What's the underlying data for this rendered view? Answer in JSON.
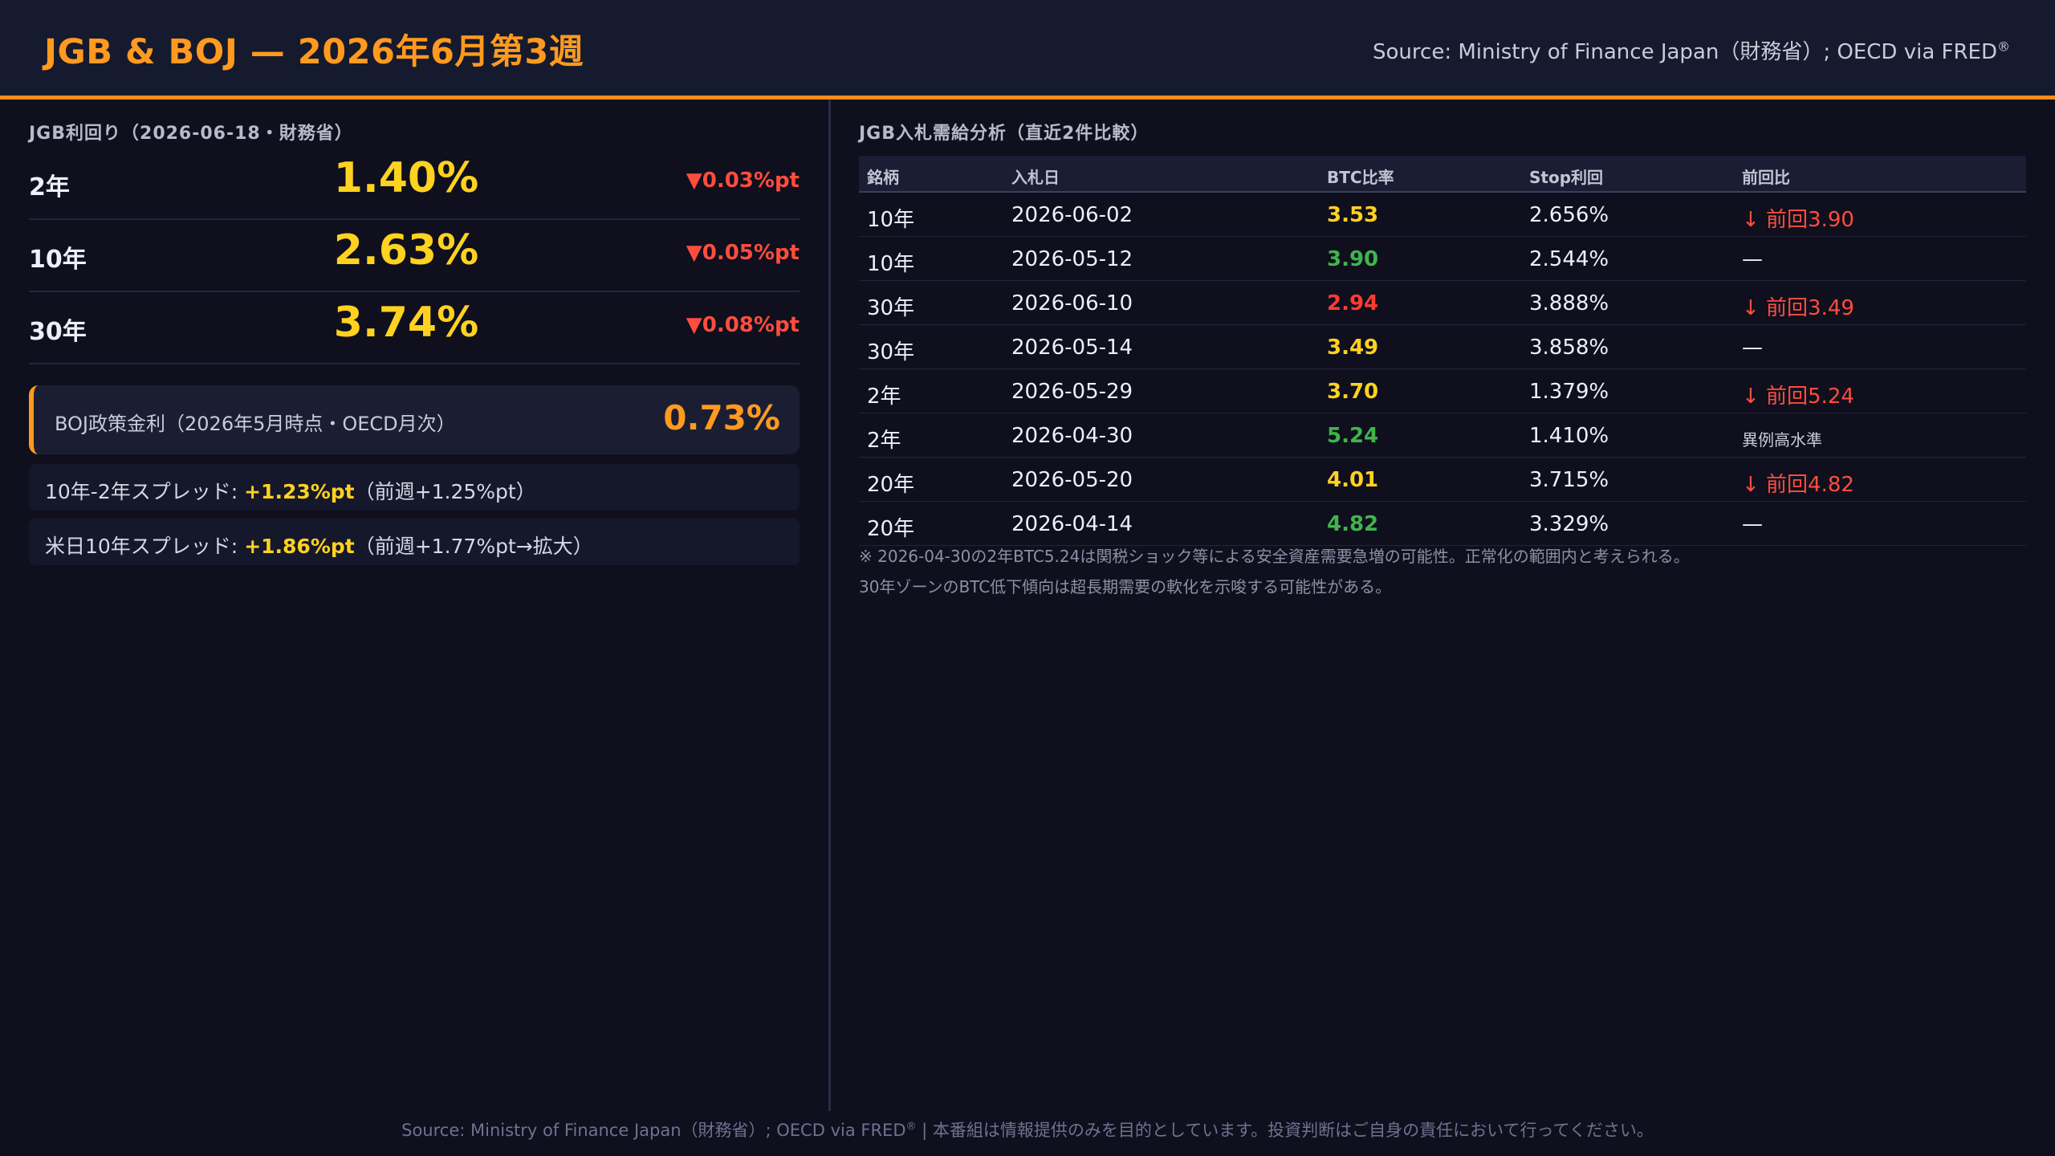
{
  "header": {
    "title": "JGB & BOJ — 2026年6月第3週",
    "source": "Source: Ministry of Finance Japan（財務省）; OECD via FRED",
    "source_mark": "®"
  },
  "yields": {
    "section_label": "JGB利回り（2026-06-18・財務省）",
    "rows": [
      {
        "tenor": "2年",
        "rate": "1.40%",
        "change": "▼0.03%pt"
      },
      {
        "tenor": "10年",
        "rate": "2.63%",
        "change": "▼0.05%pt"
      },
      {
        "tenor": "30年",
        "rate": "3.74%",
        "change": "▼0.08%pt"
      }
    ]
  },
  "boj": {
    "label": "BOJ政策金利（2026年5月時点・OECD月次）",
    "value": "0.73%"
  },
  "spreads": [
    {
      "prefix": "10年-2年スプレッド: ",
      "value": "+1.23%pt",
      "suffix": "（前週+1.25%pt）"
    },
    {
      "prefix": "米日10年スプレッド: ",
      "value": "+1.86%pt",
      "suffix": "（前週+1.77%pt→拡大）"
    }
  ],
  "auction": {
    "section_label": "JGB入札需給分析（直近2件比較）",
    "columns": [
      "銘柄",
      "入札日",
      "BTC比率",
      "Stop利回",
      "前回比"
    ],
    "rows": [
      {
        "issue": "10年",
        "date": "2026-06-02",
        "btc": "3.53",
        "btc_color": "yellow",
        "stop": "2.656%",
        "cmp": "↓ 前回3.90",
        "cmp_style": "red"
      },
      {
        "issue": "10年",
        "date": "2026-05-12",
        "btc": "3.90",
        "btc_color": "green",
        "stop": "2.544%",
        "cmp": "—",
        "cmp_style": "plain"
      },
      {
        "issue": "30年",
        "date": "2026-06-10",
        "btc": "2.94",
        "btc_color": "red",
        "stop": "3.888%",
        "cmp": "↓ 前回3.49",
        "cmp_style": "red"
      },
      {
        "issue": "30年",
        "date": "2026-05-14",
        "btc": "3.49",
        "btc_color": "yellow",
        "stop": "3.858%",
        "cmp": "—",
        "cmp_style": "plain"
      },
      {
        "issue": "2年",
        "date": "2026-05-29",
        "btc": "3.70",
        "btc_color": "yellow",
        "stop": "1.379%",
        "cmp": "↓ 前回5.24",
        "cmp_style": "red"
      },
      {
        "issue": "2年",
        "date": "2026-04-30",
        "btc": "5.24",
        "btc_color": "green",
        "stop": "1.410%",
        "cmp": "異例高水準",
        "cmp_style": "note"
      },
      {
        "issue": "20年",
        "date": "2026-05-20",
        "btc": "4.01",
        "btc_color": "yellow",
        "stop": "3.715%",
        "cmp": "↓ 前回4.82",
        "cmp_style": "red"
      },
      {
        "issue": "20年",
        "date": "2026-04-14",
        "btc": "4.82",
        "btc_color": "green",
        "stop": "3.329%",
        "cmp": "—",
        "cmp_style": "plain"
      }
    ],
    "notes": [
      "※ 2026-04-30の2年BTC5.24は関税ショック等による安全資産需要急増の可能性。正常化の範囲内と考えられる。",
      "30年ゾーンのBTC低下傾向は超長期需要の軟化を示唆する可能性がある。"
    ]
  },
  "footer": {
    "source": "Source: Ministry of Finance Japan（財務省）; OECD via FRED",
    "mark": "®",
    "disclaimer": " | 本番組は情報提供のみを目的としています。投資判断はご自身の責任において行ってください。"
  },
  "colors": {
    "accent": "#ff9a1f",
    "yield": "#ffd21f",
    "down": "#ff4d3d",
    "good": "#3fb54a",
    "bad": "#ff3d2e"
  }
}
